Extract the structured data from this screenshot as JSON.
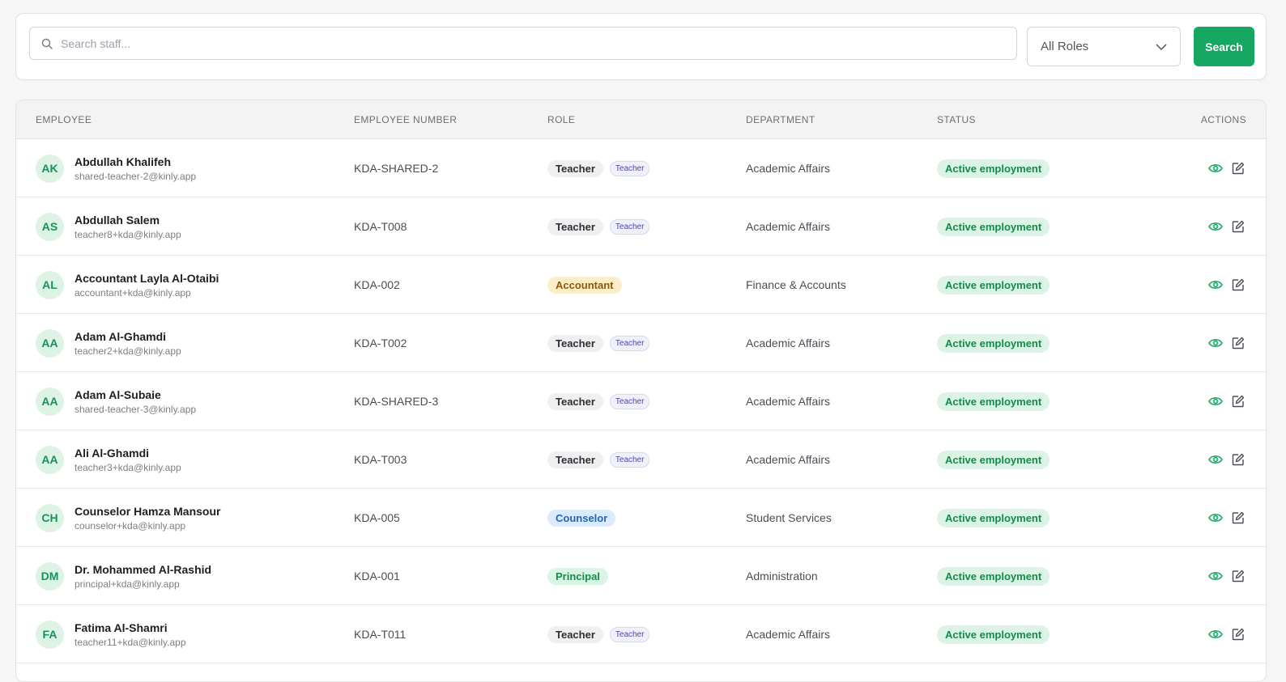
{
  "search": {
    "placeholder": "Search staff...",
    "role_filter": "All Roles",
    "button_label": "Search"
  },
  "table": {
    "columns": [
      "EMPLOYEE",
      "EMPLOYEE NUMBER",
      "ROLE",
      "DEPARTMENT",
      "STATUS",
      "ACTIONS"
    ],
    "rows": [
      {
        "initials": "AK",
        "name": "Abdullah Khalifeh",
        "email": "shared-teacher-2@kinly.app",
        "number": "KDA-SHARED-2",
        "role": "Teacher",
        "role_kind": "teacher",
        "role_sub": "Teacher",
        "department": "Academic Affairs",
        "status": "Active employment"
      },
      {
        "initials": "AS",
        "name": "Abdullah Salem",
        "email": "teacher8+kda@kinly.app",
        "number": "KDA-T008",
        "role": "Teacher",
        "role_kind": "teacher",
        "role_sub": "Teacher",
        "department": "Academic Affairs",
        "status": "Active employment"
      },
      {
        "initials": "AL",
        "name": "Accountant Layla Al-Otaibi",
        "email": "accountant+kda@kinly.app",
        "number": "KDA-002",
        "role": "Accountant",
        "role_kind": "accountant",
        "role_sub": "",
        "department": "Finance & Accounts",
        "status": "Active employment"
      },
      {
        "initials": "AA",
        "name": "Adam Al-Ghamdi",
        "email": "teacher2+kda@kinly.app",
        "number": "KDA-T002",
        "role": "Teacher",
        "role_kind": "teacher",
        "role_sub": "Teacher",
        "department": "Academic Affairs",
        "status": "Active employment"
      },
      {
        "initials": "AA",
        "name": "Adam Al-Subaie",
        "email": "shared-teacher-3@kinly.app",
        "number": "KDA-SHARED-3",
        "role": "Teacher",
        "role_kind": "teacher",
        "role_sub": "Teacher",
        "department": "Academic Affairs",
        "status": "Active employment"
      },
      {
        "initials": "AA",
        "name": "Ali Al-Ghamdi",
        "email": "teacher3+kda@kinly.app",
        "number": "KDA-T003",
        "role": "Teacher",
        "role_kind": "teacher",
        "role_sub": "Teacher",
        "department": "Academic Affairs",
        "status": "Active employment"
      },
      {
        "initials": "CH",
        "name": "Counselor Hamza Mansour",
        "email": "counselor+kda@kinly.app",
        "number": "KDA-005",
        "role": "Counselor",
        "role_kind": "counselor",
        "role_sub": "",
        "department": "Student Services",
        "status": "Active employment"
      },
      {
        "initials": "DM",
        "name": "Dr. Mohammed Al-Rashid",
        "email": "principal+kda@kinly.app",
        "number": "KDA-001",
        "role": "Principal",
        "role_kind": "principal",
        "role_sub": "",
        "department": "Administration",
        "status": "Active employment"
      },
      {
        "initials": "FA",
        "name": "Fatima Al-Shamri",
        "email": "teacher11+kda@kinly.app",
        "number": "KDA-T011",
        "role": "Teacher",
        "role_kind": "teacher",
        "role_sub": "Teacher",
        "department": "Academic Affairs",
        "status": "Active employment"
      }
    ]
  },
  "icons": {
    "search": "search-icon",
    "dropdown": "chevron-down-icon",
    "view": "eye-icon",
    "edit": "edit-icon"
  },
  "colors": {
    "accent": "#16a862",
    "status_bg": "#dcf4e5",
    "status_text": "#17894d"
  }
}
